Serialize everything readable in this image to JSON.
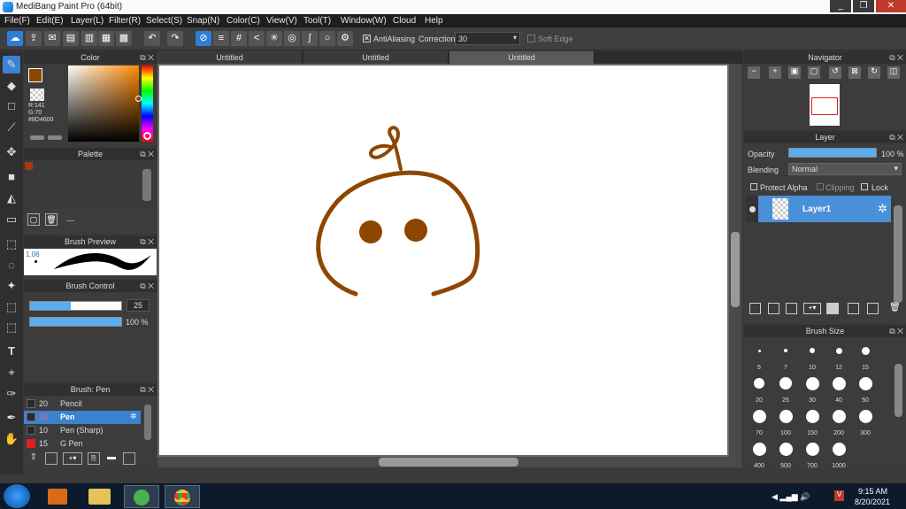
{
  "app": {
    "title": "MediBang Paint Pro (64bit)",
    "min": "_",
    "max": "❐",
    "close": "✕"
  },
  "menu": [
    "File(F)",
    "Edit(E)",
    "Layer(L)",
    "Filter(R)",
    "Select(S)",
    "Snap(N)",
    "Color(C)",
    "View(V)",
    "Tool(T)",
    "Window(W)",
    "Cloud",
    "Help"
  ],
  "toolbar": {
    "antialiasing": "AntiAliasing",
    "correction_label": "Correction",
    "correction_value": "30",
    "soft_edge": "Soft Edge"
  },
  "tabs": [
    "Untitled",
    "Untitled",
    "Untitled"
  ],
  "color": {
    "title": "Color",
    "r": "R:141",
    "g": "G:70",
    "hex": "#8D4600",
    "swatch": "#8d4600"
  },
  "palette": {
    "title": "Palette",
    "label": "---"
  },
  "brush_preview": {
    "title": "Brush Preview",
    "size": "1.06"
  },
  "brush_control": {
    "title": "Brush Control",
    "size_value": "25",
    "opacity_value": "100 %",
    "size_fraction": 0.45,
    "opacity_fraction": 1.0
  },
  "brush_list": {
    "title": "Brush: Pen",
    "items": [
      {
        "size": "20",
        "name": "Pencil",
        "color": "#2a2a2a"
      },
      {
        "size": "25",
        "name": "Pen",
        "color": "#2a2a2a",
        "selected": true
      },
      {
        "size": "10",
        "name": "Pen (Sharp)",
        "color": "#2a2a2a"
      },
      {
        "size": "15",
        "name": "G Pen",
        "color": "#e02020"
      }
    ]
  },
  "navigator": {
    "title": "Navigator"
  },
  "layer": {
    "title": "Layer",
    "opacity_label": "Opacity",
    "opacity_value": "100 %",
    "blending_label": "Blending",
    "blending_value": "Normal",
    "protect_alpha": "Protect Alpha",
    "clipping": "Clipping",
    "lock": "Lock",
    "layer_name": "Layer1"
  },
  "brush_size": {
    "title": "Brush Size",
    "sizes": [
      "5",
      "7",
      "10",
      "12",
      "15",
      "20",
      "25",
      "30",
      "40",
      "50",
      "70",
      "100",
      "150",
      "200",
      "300",
      "400",
      "500",
      "700",
      "1000"
    ]
  },
  "taskbar": {
    "time": "9:15 AM",
    "date": "8/20/2021"
  }
}
